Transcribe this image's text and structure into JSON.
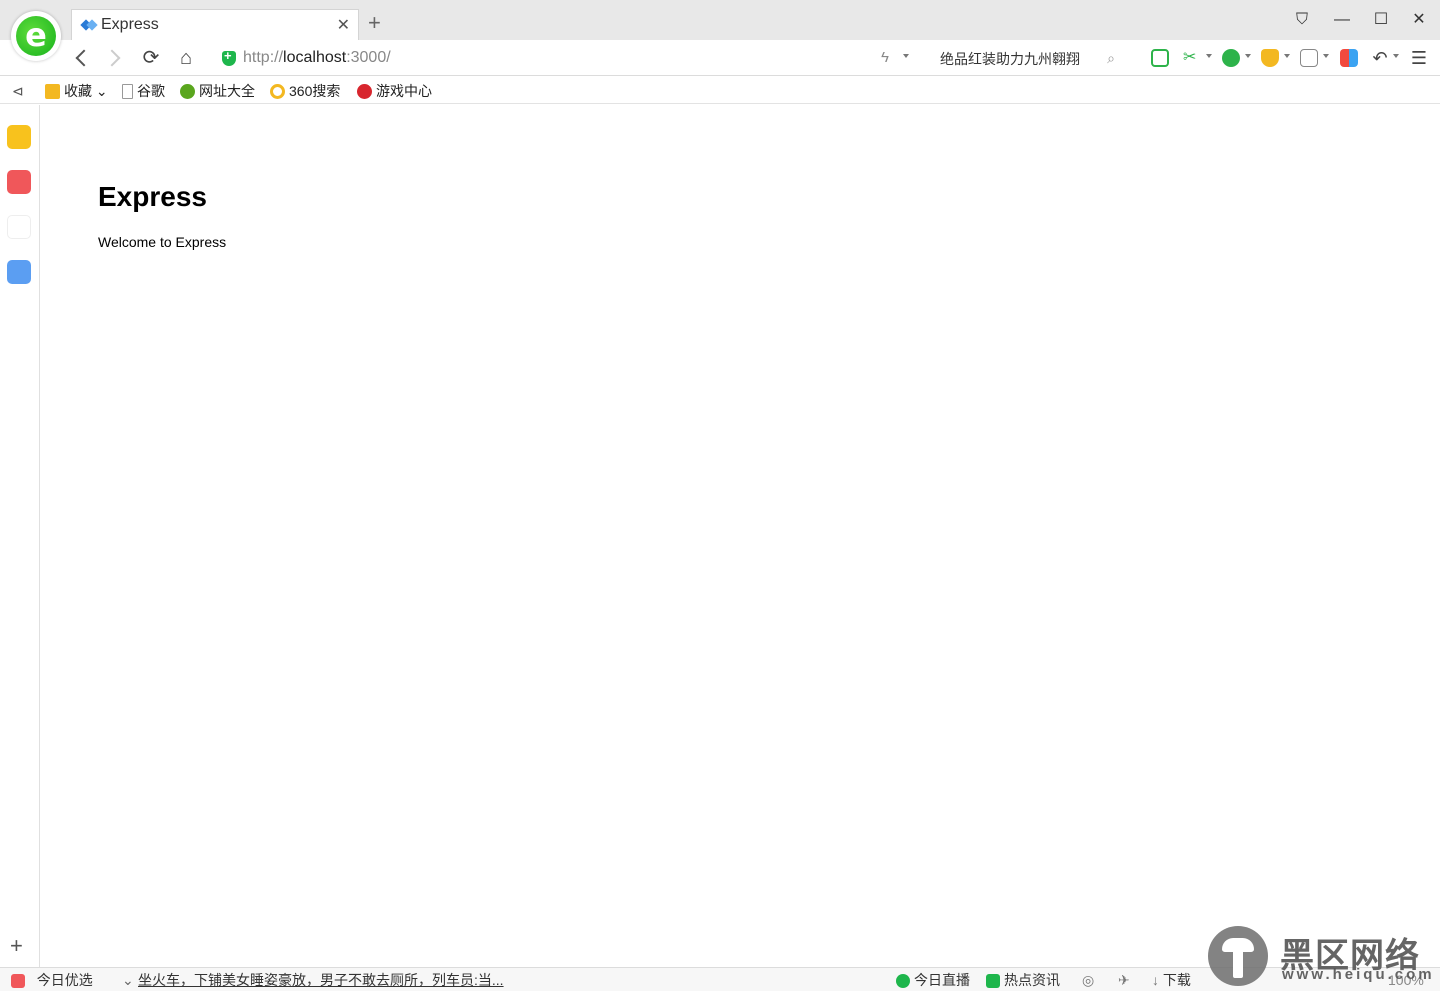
{
  "browser": {
    "tab": {
      "title": "Express"
    },
    "address": {
      "scheme": "http://",
      "host": "localhost",
      "rest": ":3000/"
    },
    "search_text": "绝品红装助力九州翱翔"
  },
  "bookmarks": [
    {
      "label": "收藏"
    },
    {
      "label": "谷歌"
    },
    {
      "label": "网址大全"
    },
    {
      "label": "360搜索"
    },
    {
      "label": "游戏中心"
    }
  ],
  "page": {
    "heading": "Express",
    "body": "Welcome to Express"
  },
  "statusbar": {
    "picks": "今日优选",
    "news": "坐火车，下铺美女睡姿豪放，男子不敢去厕所，列车员:当...",
    "live": "今日直播",
    "hot": "热点资讯",
    "download": "下载",
    "zoom": "100%"
  },
  "watermark": {
    "name": "黑区网络",
    "domain": "www.heiqu.com"
  },
  "colors": {
    "accent_green": "#1eb64c",
    "brand_blue": "#2a7bd6"
  }
}
